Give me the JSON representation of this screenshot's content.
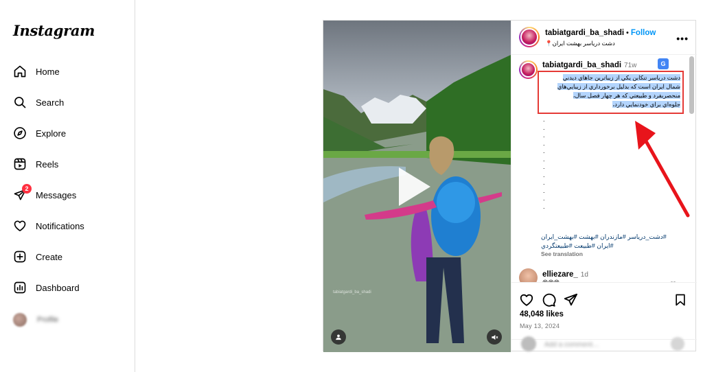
{
  "app": {
    "logo": "Instagram"
  },
  "sidebar": {
    "items": [
      {
        "label": "Home",
        "icon": "home-icon"
      },
      {
        "label": "Search",
        "icon": "search-icon"
      },
      {
        "label": "Explore",
        "icon": "compass-icon"
      },
      {
        "label": "Reels",
        "icon": "reels-icon"
      },
      {
        "label": "Messages",
        "icon": "messages-icon",
        "badge": "2"
      },
      {
        "label": "Notifications",
        "icon": "heart-icon"
      },
      {
        "label": "Create",
        "icon": "plus-square-icon"
      },
      {
        "label": "Dashboard",
        "icon": "dashboard-icon"
      },
      {
        "label": "Profile",
        "icon": "avatar"
      }
    ]
  },
  "post": {
    "username": "tabiatgardi_ba_shadi",
    "follow_label": "Follow",
    "location": "دشت درياسر بهشت ايران📍",
    "media_watermark": "tabiatgardi_ba_shadi",
    "caption": {
      "username": "tabiatgardi_ba_shadi",
      "time": "71w",
      "translate_icon_label": "G",
      "text_lines": [
        "دشت درياسر تنكابن يكي از زيباترين جاهاي ديدني",
        "شمال ايران است كه بدليل برخورداري از زيبايي‌هاي",
        "منحصربفرد و طبيعتي كه هر چهار فصل سال،",
        "جلوه‌اي براي خودنمايي دارد،"
      ],
      "dots": ".\n.\n.\n.\n.\n.\n.\n.\n.\n.\n.\n.",
      "hashtags_line1": "#دشت_درياسر #مازندران #بهشت #بهشت_ايران",
      "hashtags_line2": "#ايران #طبيعت #طبيعتگردي",
      "see_translation": "See translation"
    },
    "comment": {
      "username": "elliezare_",
      "time": "1d",
      "text": "😍😍😍"
    },
    "likes": "48,048 likes",
    "date": "May 13, 2024",
    "add_comment_placeholder": "Add a comment…",
    "colors": {
      "accent": "#0095f6",
      "highlight_box": "#e53935",
      "arrow": "#e8141b",
      "badge": "#ff3040"
    }
  }
}
